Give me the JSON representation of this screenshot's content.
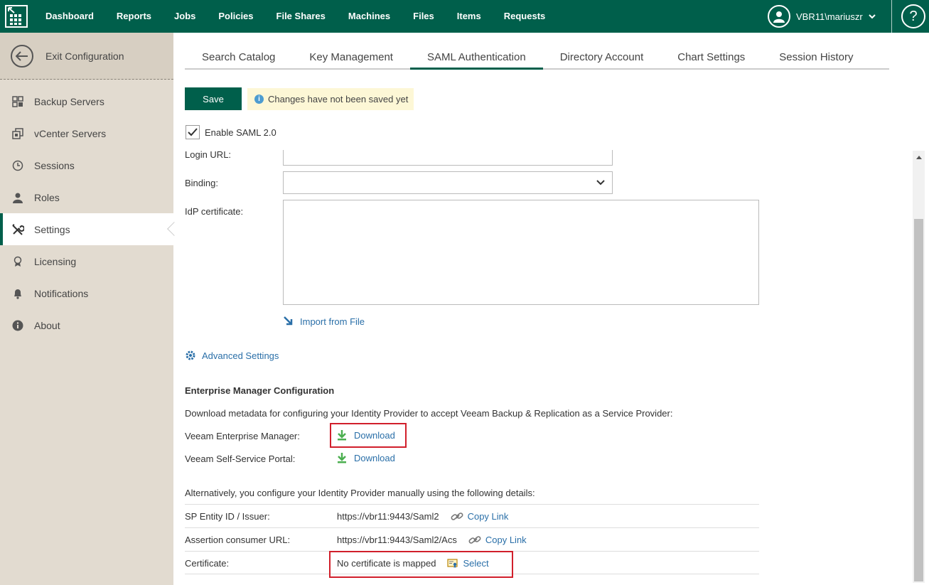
{
  "header": {
    "nav": [
      "Dashboard",
      "Reports",
      "Jobs",
      "Policies",
      "File Shares",
      "Machines",
      "Files",
      "Items",
      "Requests"
    ],
    "user": "VBR11\\mariuszr",
    "help": "?"
  },
  "sidebar": {
    "exit_label": "Exit Configuration",
    "items": [
      {
        "label": "Backup Servers",
        "icon": "backup-servers-icon"
      },
      {
        "label": "vCenter Servers",
        "icon": "vcenter-icon"
      },
      {
        "label": "Sessions",
        "icon": "clock-icon"
      },
      {
        "label": "Roles",
        "icon": "user-icon"
      },
      {
        "label": "Settings",
        "icon": "tools-icon",
        "active": true
      },
      {
        "label": "Licensing",
        "icon": "license-icon"
      },
      {
        "label": "Notifications",
        "icon": "bell-icon"
      },
      {
        "label": "About",
        "icon": "info-icon"
      }
    ]
  },
  "tabs": [
    "Search Catalog",
    "Key Management",
    "SAML Authentication",
    "Directory Account",
    "Chart Settings",
    "Session History"
  ],
  "active_tab": "SAML Authentication",
  "toolbar": {
    "save_label": "Save",
    "notice": "Changes have not been saved yet"
  },
  "saml": {
    "enable_label": "Enable SAML 2.0",
    "enabled": true,
    "login_url_label": "Login URL:",
    "login_url_value": "",
    "binding_label": "Binding:",
    "binding_value": "",
    "idp_cert_label": "IdP certificate:",
    "idp_cert_value": "",
    "import_label": "Import from File",
    "advanced_label": "Advanced Settings"
  },
  "em_config": {
    "title": "Enterprise Manager Configuration",
    "description": "Download metadata for configuring your Identity Provider to accept Veeam Backup & Replication as a Service Provider:",
    "downloads": [
      {
        "label": "Veeam Enterprise Manager:",
        "link": "Download"
      },
      {
        "label": "Veeam Self-Service Portal:",
        "link": "Download"
      }
    ],
    "alt_description": "Alternatively, you configure your Identity Provider manually using the following details:",
    "details": [
      {
        "label": "SP Entity ID / Issuer:",
        "value": "https://vbr11:9443/Saml2",
        "action": "Copy Link"
      },
      {
        "label": "Assertion consumer URL:",
        "value": "https://vbr11:9443/Saml2/Acs",
        "action": "Copy Link"
      },
      {
        "label": "Certificate:",
        "value": "No certificate is mapped",
        "action": "Select"
      }
    ]
  },
  "colors": {
    "brand": "#005f4b",
    "link": "#2a6fa8",
    "highlight": "#d11f2b",
    "download_icon": "#4caf50"
  }
}
